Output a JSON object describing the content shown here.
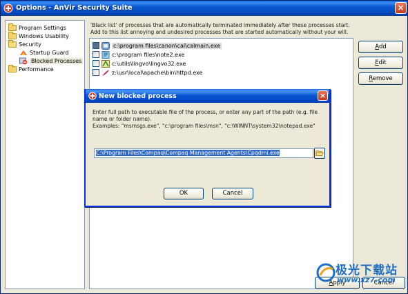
{
  "window": {
    "title": "Options - AnVir Security Suite",
    "close_glyph": "×"
  },
  "tree": {
    "items": [
      {
        "label": "Program Settings",
        "icon": "folder-icon"
      },
      {
        "label": "Windows Usability",
        "icon": "folder-icon"
      },
      {
        "label": "Security",
        "icon": "folder-open-icon"
      },
      {
        "label": "Startup Guard",
        "icon": "startup-guard-icon"
      },
      {
        "label": "Blocked Processes",
        "icon": "blocked-processes-icon",
        "selected": true
      },
      {
        "label": "Performance",
        "icon": "folder-icon"
      }
    ]
  },
  "description": {
    "line1": "'Black list' of processes that are automatically terminated immediately after these processes start.",
    "line2": "Add to this list annoying and undesired processes that are started automatically without your will."
  },
  "process_list": {
    "rows": [
      {
        "path": "c:\\program files\\canon\\cal\\calmain.exe",
        "checked": false,
        "highlighted": true
      },
      {
        "path": "c:\\program files\\note2.exe",
        "checked": false
      },
      {
        "path": "c:\\utils\\lingvo\\lingvo32.exe",
        "checked": false
      },
      {
        "path": "z:\\usr\\local\\apache\\bin\\httpd.exe",
        "checked": false
      }
    ]
  },
  "buttons": {
    "add": {
      "first": "A",
      "rest": "dd"
    },
    "edit": {
      "first": "E",
      "rest": "dit"
    },
    "remove": {
      "first": "R",
      "rest": "emove"
    },
    "apply": {
      "first": "A",
      "rest": "pply"
    },
    "cancel": "Cancel"
  },
  "dialog": {
    "title": "New blocked process",
    "close_glyph": "×",
    "instruction": "Enter full path to executable file of the process, or enter any part of the path (e.g. file name or folder name).",
    "examples": "Examples: \"msmsgs.exe\", \"c:\\program files\\msn\", \"c:\\WINNT\\system32\\notepad.exe\"",
    "path_value": "C:\\Program Files\\Compaq\\Compaq Management Agents\\Cpqdmi.exe",
    "ok_label": "OK",
    "cancel_label": "Cancel"
  },
  "watermark": {
    "text": "极光下载站",
    "url": "www.xz7.com"
  },
  "colors": {
    "titlebar": "#0a59d3",
    "selection": "#316ac5",
    "close": "#c4391b"
  }
}
